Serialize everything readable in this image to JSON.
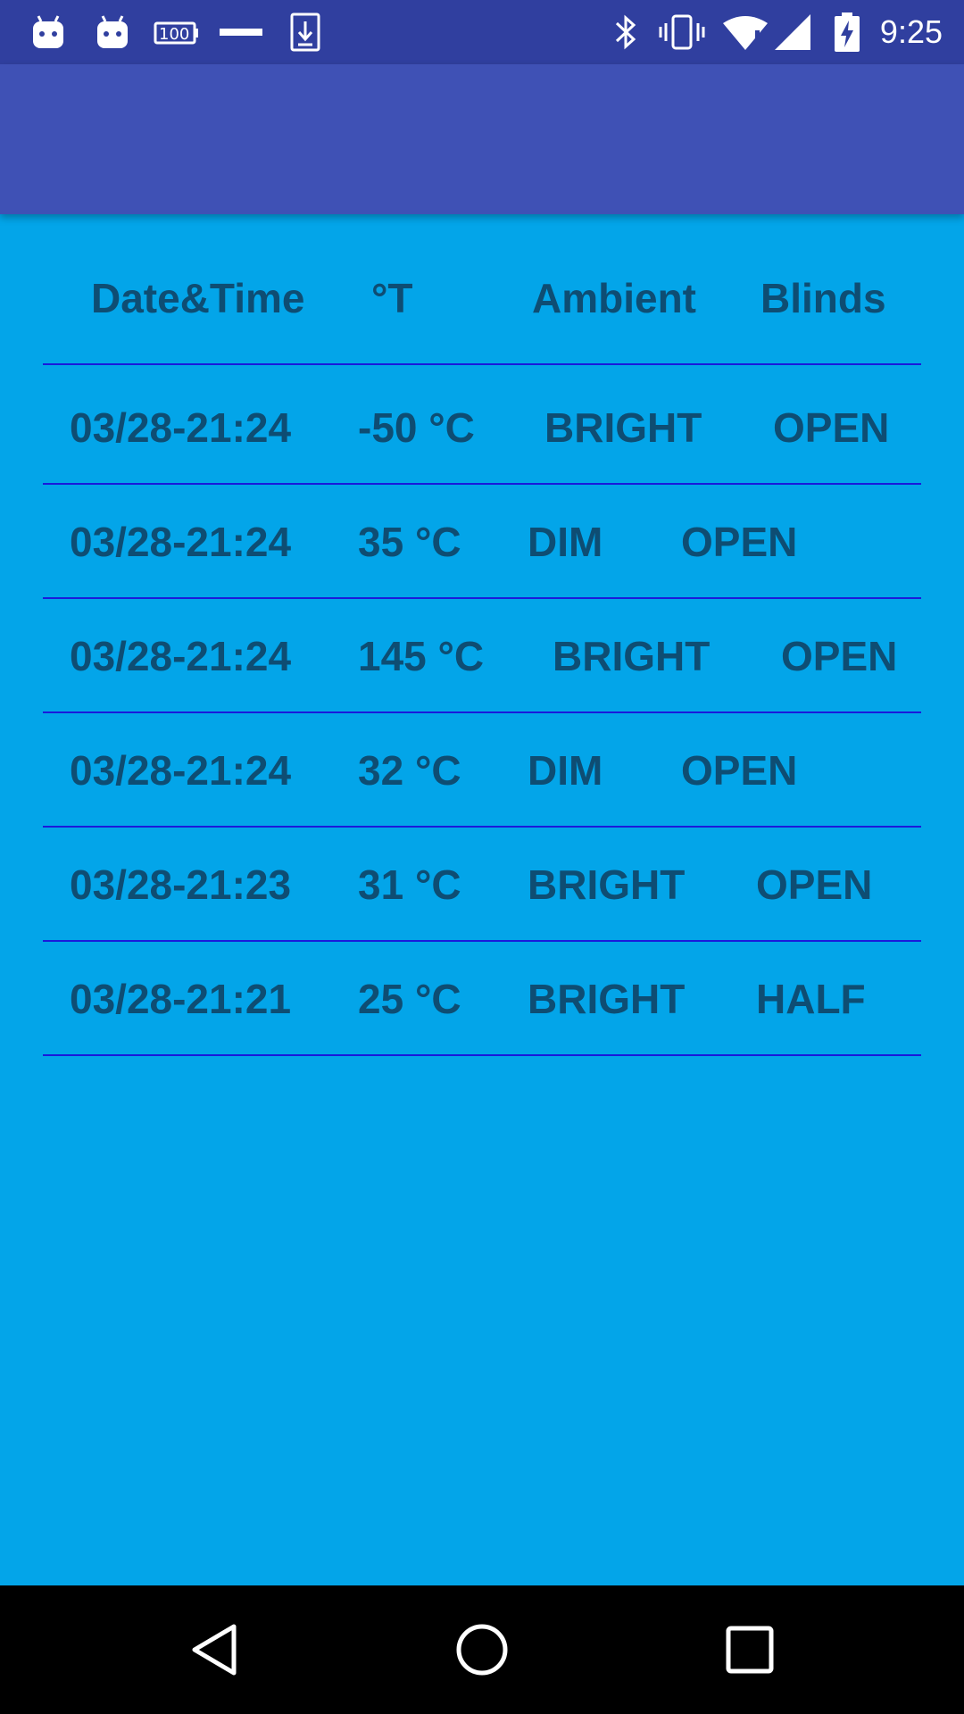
{
  "status_bar": {
    "time": "9:25",
    "icons_left": [
      "android-icon",
      "android-icon",
      "battery-100-icon",
      "minus-icon",
      "download-icon"
    ],
    "icons_right": [
      "bluetooth-icon",
      "vibrate-icon",
      "wifi-alert-icon",
      "cell-signal-icon",
      "battery-charging-icon"
    ]
  },
  "table": {
    "headers": [
      "Date&Time",
      "°T",
      "Ambient",
      "Blinds"
    ],
    "rows": [
      {
        "datetime": "03/28-21:24",
        "temp": "-50 °C",
        "ambient": "BRIGHT",
        "blinds": "OPEN"
      },
      {
        "datetime": "03/28-21:24",
        "temp": "35 °C",
        "ambient": "DIM",
        "blinds": "OPEN"
      },
      {
        "datetime": "03/28-21:24",
        "temp": "145 °C",
        "ambient": "BRIGHT",
        "blinds": "OPEN"
      },
      {
        "datetime": "03/28-21:24",
        "temp": "32 °C",
        "ambient": "DIM",
        "blinds": "OPEN"
      },
      {
        "datetime": "03/28-21:23",
        "temp": "31 °C",
        "ambient": "BRIGHT",
        "blinds": "OPEN"
      },
      {
        "datetime": "03/28-21:21",
        "temp": "25 °C",
        "ambient": "BRIGHT",
        "blinds": "HALF"
      }
    ]
  },
  "nav_bar": {
    "buttons": [
      "back-icon",
      "home-icon",
      "recents-icon"
    ]
  },
  "colors": {
    "status_bar": "#303f9f",
    "app_bar": "#3f51b5",
    "background": "#03a5e9",
    "text": "#0e4d73",
    "divider": "#1a1adb",
    "nav_bar": "#000000"
  }
}
